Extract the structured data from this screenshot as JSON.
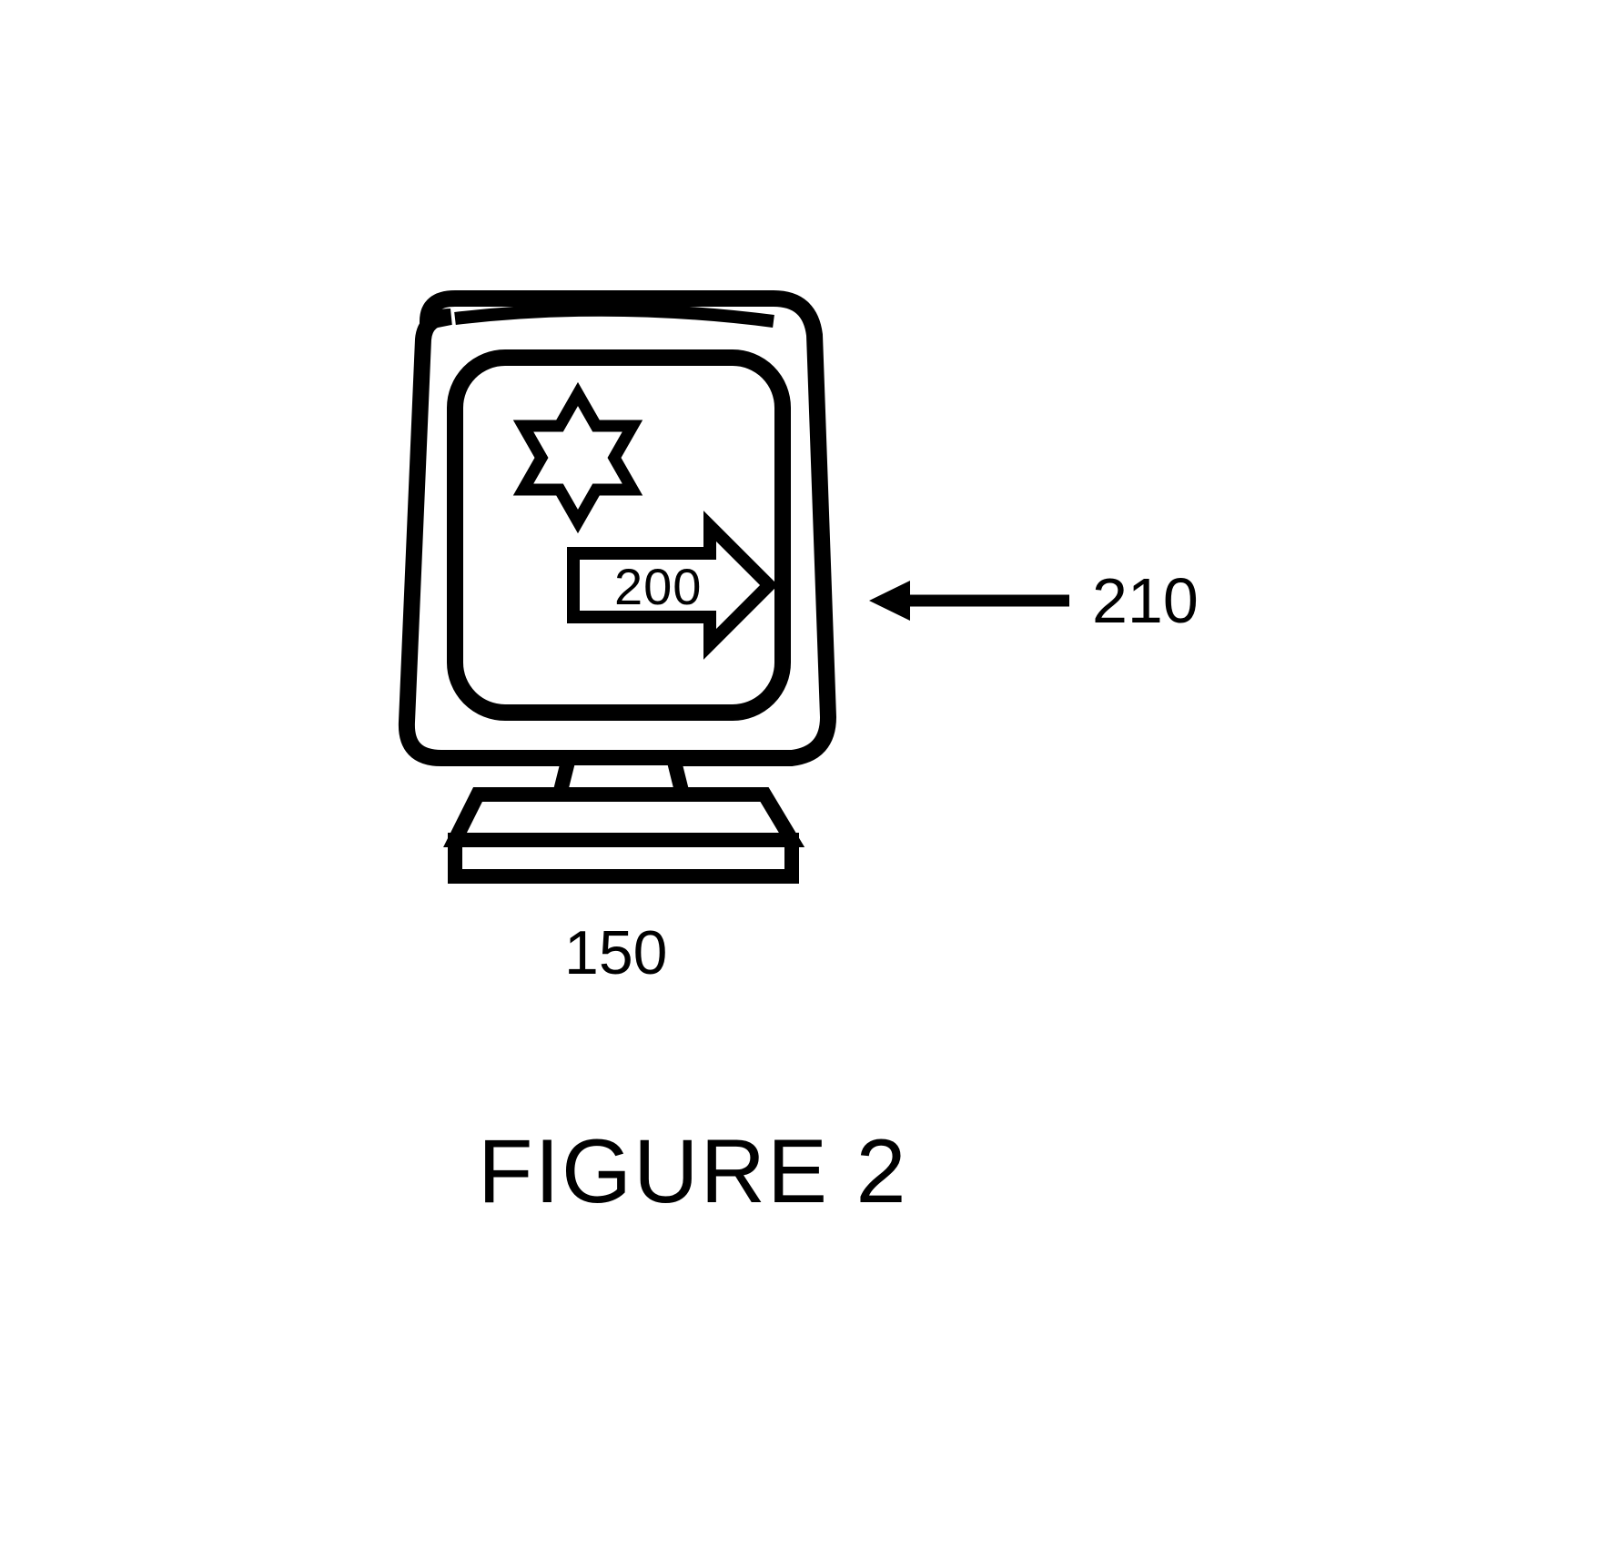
{
  "labels": {
    "arrow_value": "200",
    "pointer_label": "210",
    "monitor_label": "150"
  },
  "caption": "FIGURE 2"
}
